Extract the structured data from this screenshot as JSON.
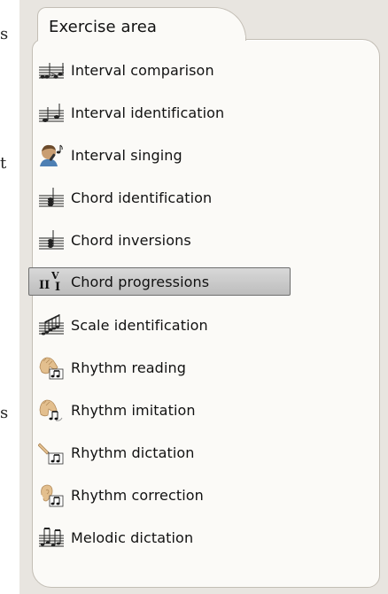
{
  "left_fragment": [
    "s",
    "t",
    "s"
  ],
  "panel": {
    "title": "Exercise area",
    "selected_index": 5,
    "items": [
      {
        "label": "Interval comparison",
        "icon": "interval-comparison-icon"
      },
      {
        "label": "Interval identification",
        "icon": "interval-identification-icon"
      },
      {
        "label": "Interval singing",
        "icon": "interval-singing-icon"
      },
      {
        "label": "Chord identification",
        "icon": "chord-identification-icon"
      },
      {
        "label": "Chord inversions",
        "icon": "chord-inversions-icon"
      },
      {
        "label": "Chord progressions",
        "icon": "chord-progressions-icon"
      },
      {
        "label": "Scale identification",
        "icon": "scale-identification-icon"
      },
      {
        "label": "Rhythm reading",
        "icon": "rhythm-reading-icon"
      },
      {
        "label": "Rhythm imitation",
        "icon": "rhythm-imitation-icon"
      },
      {
        "label": "Rhythm dictation",
        "icon": "rhythm-dictation-icon"
      },
      {
        "label": "Rhythm correction",
        "icon": "rhythm-correction-icon"
      },
      {
        "label": "Melodic dictation",
        "icon": "melodic-dictation-icon"
      }
    ],
    "icon_symbols": {
      "chord_progressions": [
        "II",
        "V",
        "I"
      ],
      "interval_comparison": ">"
    }
  }
}
